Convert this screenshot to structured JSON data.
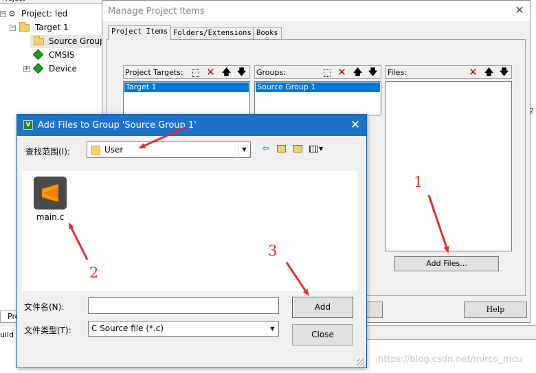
{
  "tree": {
    "header": "roject",
    "project_label": "Project: led",
    "target_label": "Target 1",
    "group_label": "Source Group",
    "cmsis_label": "CMSIS",
    "device_label": "Device",
    "expander_minus": "−",
    "expander_plus": "+"
  },
  "bottom_left": {
    "project_tab": "Pro",
    "build_label": "uild C"
  },
  "right_edge_text": "2",
  "manage_dialog": {
    "title": "Manage Project Items",
    "close_glyph": "✕",
    "tabs": [
      "Project Items",
      "Folders/Extensions",
      "Books"
    ],
    "targets_pane": {
      "label": "Project Targets:",
      "selected": "Target 1"
    },
    "groups_pane": {
      "label": "Groups:",
      "selected": "Source Group 1"
    },
    "files_pane": {
      "label": "Files:"
    },
    "add_files_button": "Add Files...",
    "help_button": "Help"
  },
  "add_dialog": {
    "title": "Add Files to Group 'Source Group 1'",
    "app_icon_letter": "V",
    "close_glyph": "✕",
    "look_in_label": "查找范围(I):",
    "look_in_value": "User",
    "file_item_name": "main.c",
    "file_name_label": "文件名(N):",
    "file_name_value": "",
    "file_type_label": "文件类型(T):",
    "file_type_value": "C Source file (*.c)",
    "add_button": "Add",
    "close_button": "Close",
    "nav_back_glyph": "⇦",
    "dropdown_glyph": "▼"
  },
  "icons": {
    "toolbar_new": "new-item-icon",
    "toolbar_delete": "delete-icon",
    "toolbar_up": "move-up-icon",
    "toolbar_down": "move-down-icon",
    "file": "sublime-text-icon"
  },
  "toolbar_glyphs": {
    "delete": "✕",
    "up": "🡅",
    "down": "🡇"
  },
  "colors": {
    "selection": "#0078d7",
    "titlebar": "#1e73c8",
    "annotation": "#e0302c"
  },
  "annotations": {
    "n1": "1",
    "n2": "2",
    "n3": "3"
  },
  "watermark": "https://blog.csdn.net/mirco_mcu"
}
